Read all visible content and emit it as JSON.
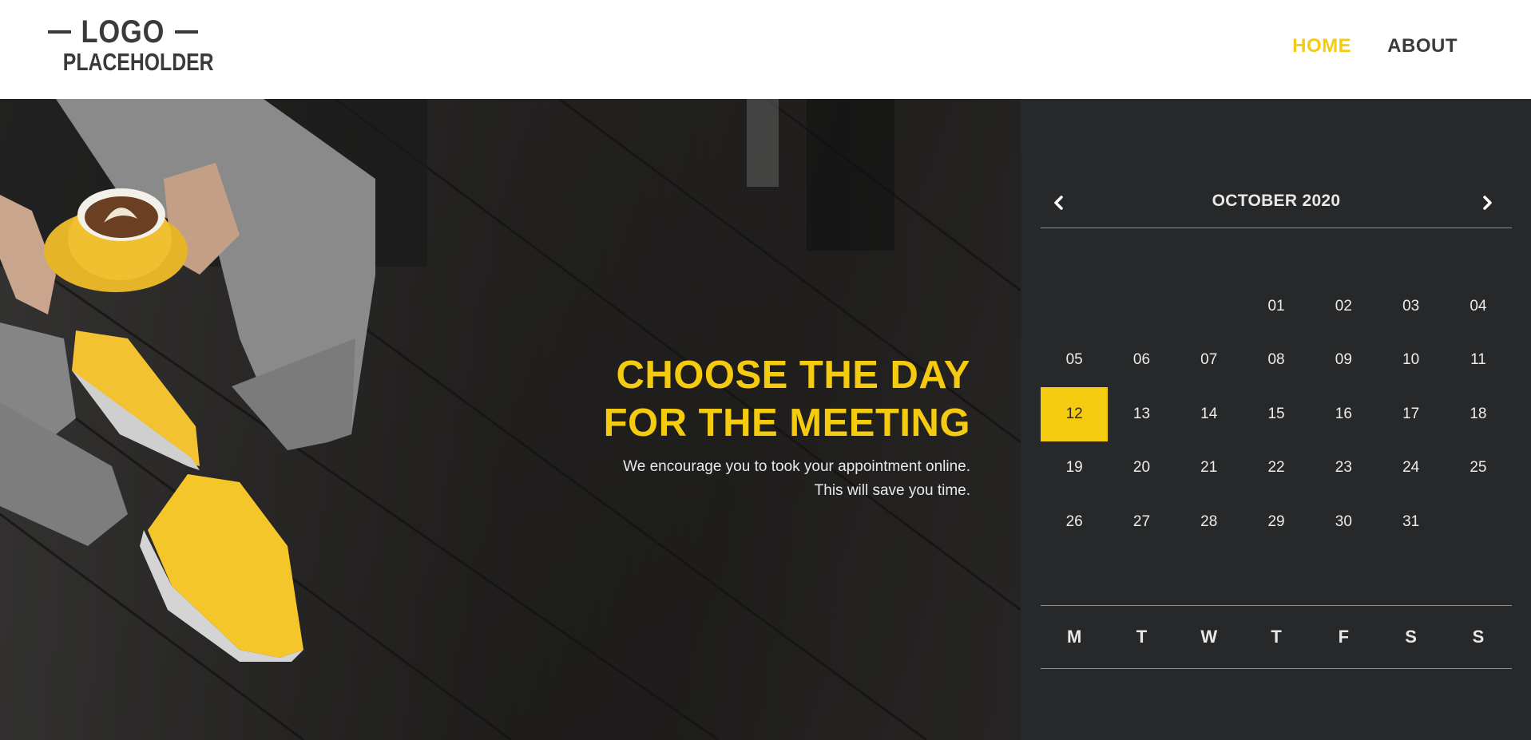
{
  "header": {
    "logo_top": "LOGO",
    "logo_bottom": "PLACEHOLDER",
    "nav": [
      {
        "label": "HOME",
        "active": true
      },
      {
        "label": "ABOUT",
        "active": false
      }
    ]
  },
  "hero": {
    "title_line1": "CHOOSE THE DAY",
    "title_line2": "FOR THE MEETING",
    "subtitle_line1": "We encourage you to took your appointment online.",
    "subtitle_line2": "This will save you time."
  },
  "calendar": {
    "prev_icon": "chevron-left-icon",
    "next_icon": "chevron-right-icon",
    "month_label": "OCTOBER 2020",
    "leading_blanks": 3,
    "days": [
      "01",
      "02",
      "03",
      "04",
      "05",
      "06",
      "07",
      "08",
      "09",
      "10",
      "11",
      "12",
      "13",
      "14",
      "15",
      "16",
      "17",
      "18",
      "19",
      "20",
      "21",
      "22",
      "23",
      "24",
      "25",
      "26",
      "27",
      "28",
      "29",
      "30",
      "31"
    ],
    "selected_day": "12",
    "weekdays": [
      "M",
      "T",
      "W",
      "T",
      "F",
      "S",
      "S"
    ]
  },
  "colors": {
    "accent": "#f5cb0f",
    "calendar_bg": "#272829",
    "text_dark": "#3a3a3a"
  }
}
